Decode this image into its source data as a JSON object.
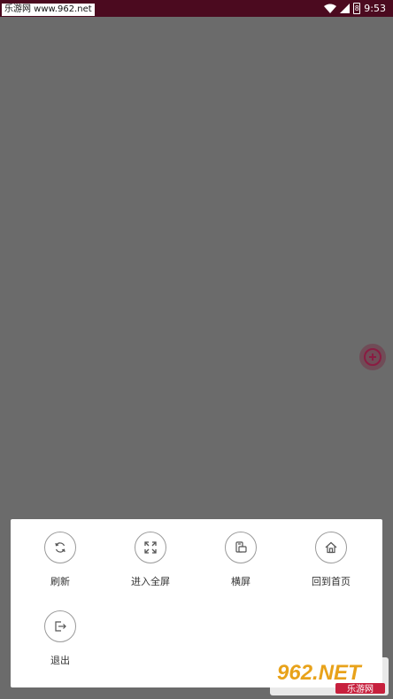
{
  "status_bar": {
    "watermark_text": "乐游网 www.962.net",
    "time": "9:53",
    "battery_level": "8"
  },
  "menu": {
    "items": [
      {
        "label": "刷新",
        "icon": "refresh-icon"
      },
      {
        "label": "进入全屏",
        "icon": "fullscreen-icon"
      },
      {
        "label": "横屏",
        "icon": "rotate-landscape-icon"
      },
      {
        "label": "回到首页",
        "icon": "home-icon"
      },
      {
        "label": "退出",
        "icon": "exit-icon"
      }
    ]
  },
  "watermark": {
    "brand": "962.NET",
    "subtitle": "乐游网"
  },
  "colors": {
    "status_bar": "#4b0a1f",
    "overlay": "#6b6b6b",
    "accent": "#8a1c42"
  }
}
